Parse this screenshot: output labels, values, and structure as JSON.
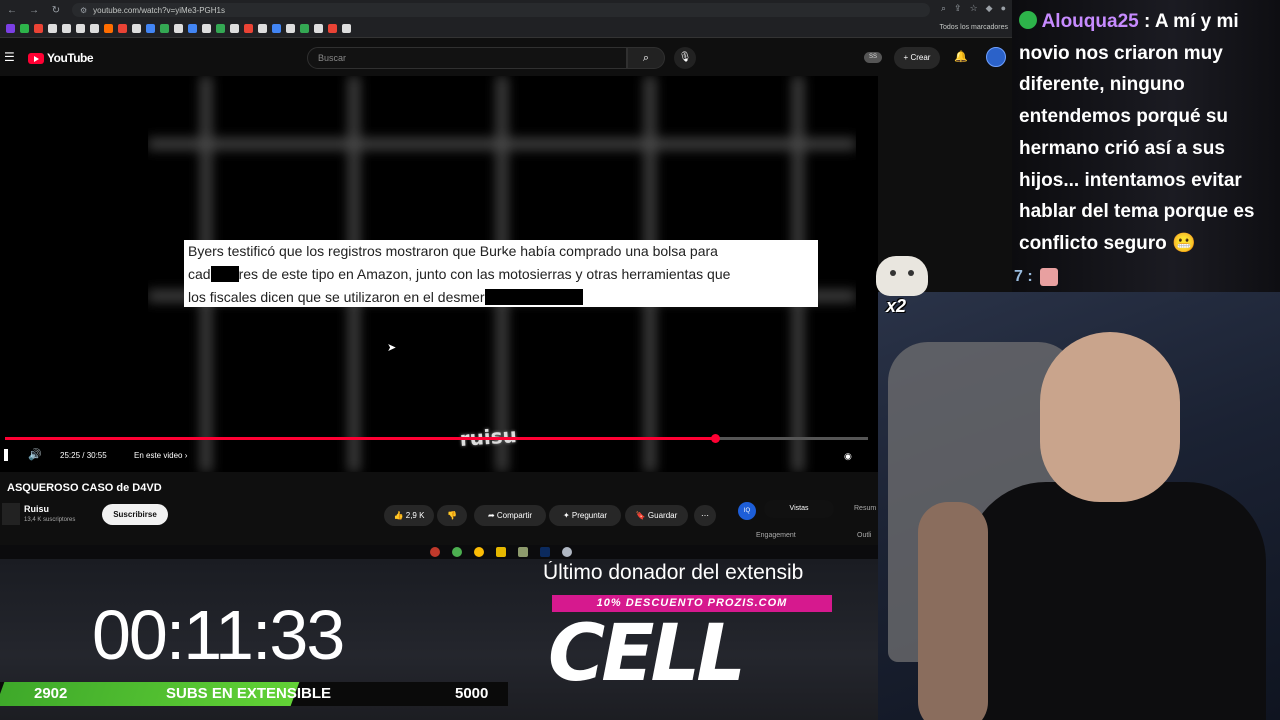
{
  "browser": {
    "url": "youtube.com/watch?v=yiMe3-PGH1s",
    "all_bookmarks_label": "Todos los marcadores"
  },
  "youtube": {
    "logo_text": "YouTube",
    "search_placeholder": "Buscar",
    "ss_badge": "SS",
    "create_label": "Crear"
  },
  "player": {
    "subtitle_line1": "Byers testificó que los registros mostraron que Burke había comprado una bolsa para",
    "subtitle_line2_a": "cad",
    "subtitle_line2_b": "res de este tipo en Amazon, junto con las motosierras y otras herramientas que",
    "subtitle_line3": "los fiscales dicen que se utilizaron en el desmer",
    "time": "25:25 / 30:55",
    "progress_fraction": 0.8226,
    "chapter_label": "En este video",
    "watermark": "ruisu"
  },
  "video": {
    "title": "ASQUEROSO CASO de D4VD",
    "channel_name": "Ruisu",
    "channel_subs": "13,4 K suscriptores",
    "subscribe_label": "Suscribirse",
    "likes": "2,9 K",
    "share_label": "Compartir",
    "ask_label": "Preguntar",
    "save_label": "Guardar"
  },
  "side_panel": {
    "iq_badge": "IQ",
    "tab_views": "Vistas",
    "tab_summary": "Resum",
    "engagement_label": "Engagement",
    "outline_label": "Outli"
  },
  "stream_overlay": {
    "timer": "00:11:33",
    "subs_current": "2902",
    "subs_label": "SUBS EN EXTENSIBLE",
    "subs_goal": "5000",
    "subs_fraction": 0.5804,
    "donor_label": "Último donador del extensib",
    "promo_banner": "10% DESCUENTO PROZIS.COM",
    "cell_logo": "CELL",
    "cat_emote_label": "x2"
  },
  "chat": {
    "user": "Alouqua25",
    "message": " : A mí y mi novio nos criaron muy diferente, ninguno entendemos porqué su hermano crió así a sus hijos... intentamos evitar hablar del tema porque es conflicto seguro",
    "next_line": "7 :"
  },
  "colors": {
    "accent": "#ff0033",
    "chat_user": "#c78bff",
    "promo": "#d6198e",
    "subs_bar": "#62d236"
  }
}
